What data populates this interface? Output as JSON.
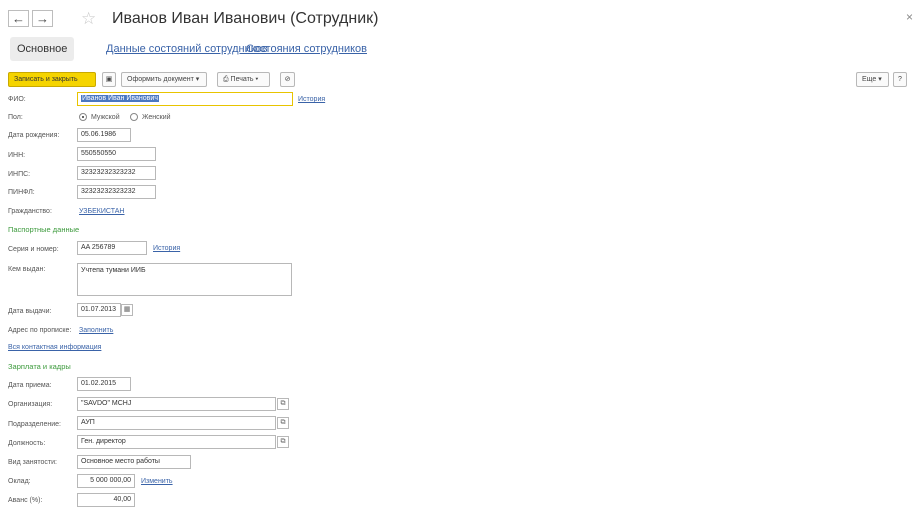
{
  "window": {
    "title": "Иванов Иван Иванович (Сотрудник)",
    "close_glyph": "×"
  },
  "nav": {
    "back_glyph": "←",
    "forward_glyph": "→",
    "star_glyph": "☆"
  },
  "tabs": [
    {
      "label": "Основное"
    },
    {
      "label": "Данные состояний сотрудников"
    },
    {
      "label": "Состояния сотрудников"
    }
  ],
  "toolbar": {
    "save_close": "Записать и закрыть",
    "save_icon": "▣",
    "create_doc": "Оформить документ ▾",
    "print": "⎙ Печать ▾",
    "attach_icon": "⊘",
    "more": "Еще ▾",
    "help": "?"
  },
  "person": {
    "fio_label": "ФИО:",
    "fio_value": "Иванов Иван Иванович",
    "history_link": "История",
    "sex_label": "Пол:",
    "sex_male": "Мужской",
    "sex_female": "Женский",
    "sex_selected": "male",
    "birth_label": "Дата рождения:",
    "birth_value": "05.06.1986",
    "inn_label": "ИНН:",
    "inn_value": "550550550",
    "inps_label": "ИНПС:",
    "inps_value": "32323232323232",
    "pinfl_label": "ПИНФЛ:",
    "pinfl_value": "32323232323232",
    "citizenship_label": "Гражданство:",
    "citizenship_value": "УЗБЕКИСТАН"
  },
  "passport": {
    "section_title": "Паспортные данные",
    "series_label": "Серия и номер:",
    "series_value": "AA 256789",
    "history_link": "История",
    "issued_by_label": "Кем выдан:",
    "issued_by_value": "Учтепа тумани ИИБ",
    "issue_date_label": "Дата выдачи:",
    "issue_date_value": "01.07.2013",
    "address_label": "Адрес по прописке:",
    "address_link": "Заполнить",
    "contact_link": "Вся контактная информация"
  },
  "hr": {
    "section_title": "Зарплата и кадры",
    "hire_date_label": "Дата приема:",
    "hire_date_value": "01.02.2015",
    "org_label": "Организация:",
    "org_value": "\"SAVDO\" MCHJ",
    "dept_label": "Подразделение:",
    "dept_value": "АУП",
    "position_label": "Должность:",
    "position_value": "Ген. директор",
    "employment_label": "Вид занятости:",
    "employment_value": "Основное место работы",
    "salary_label": "Оклад:",
    "salary_value": "5 000 000,00",
    "salary_change_link": "Изменить",
    "advance_label": "Аванс (%):",
    "advance_value": "40,00"
  },
  "icons": {
    "open_glyph": "⧉",
    "calendar_glyph": "▦"
  }
}
